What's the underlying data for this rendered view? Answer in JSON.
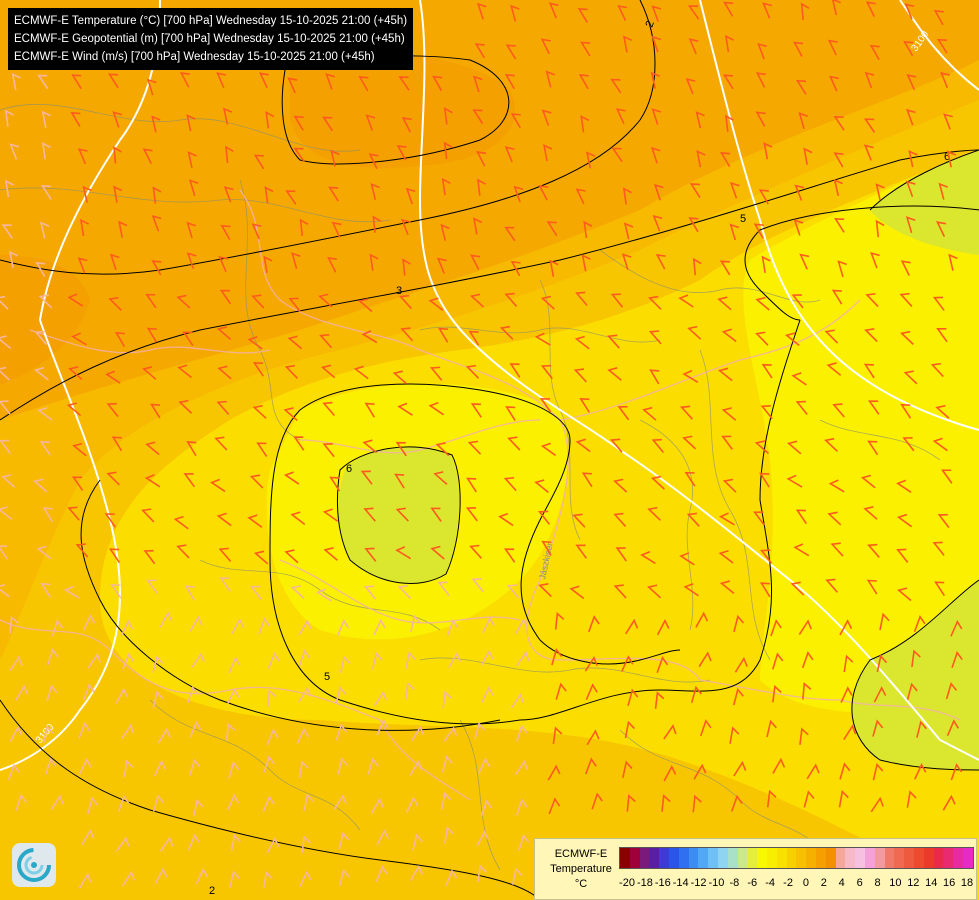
{
  "titles": [
    "ECMWF-E Temperature (°C) [700 hPa] Wednesday 15-10-2025 21:00 (+45h)",
    "ECMWF-E Geopotential (m) [700 hPa] Wednesday 15-10-2025 21:00 (+45h)",
    "ECMWF-E Wind (m/s) [700 hPa] Wednesday 15-10-2025 21:00 (+45h)"
  ],
  "map_labels": {
    "isotherm_2_top": "2",
    "isotherm_3_left": "3",
    "isotherm_5_center": "5",
    "isotherm_5_right": "5",
    "isotherm_6_center": "6",
    "isotherm_6_right": "6",
    "isotherm_2_bottom": "2",
    "geopotential_3100_bl": "3100",
    "geopotential_3100_tr": "3100",
    "river": "Jászkisér"
  },
  "legend": {
    "title_line1": "ECMWF-E",
    "title_line2": "Temperature",
    "unit": "°C",
    "ticks": [
      "-20",
      "-18",
      "-16",
      "-14",
      "-12",
      "-10",
      "-8",
      "-6",
      "-4",
      "-2",
      "0",
      "2",
      "4",
      "6",
      "8",
      "10",
      "12",
      "14",
      "16",
      "18"
    ],
    "colors": [
      "#8b0000",
      "#a0003a",
      "#7a1a7a",
      "#5a1fa0",
      "#3b3bd6",
      "#2a55e8",
      "#2f6ff0",
      "#3d8cf2",
      "#52a8f5",
      "#6fc0f5",
      "#8fd4f0",
      "#a9e0c8",
      "#cde88a",
      "#e6ee3c",
      "#f8f800",
      "#f8ee00",
      "#f8e000",
      "#f7d000",
      "#f7c000",
      "#f6b000",
      "#f5a000",
      "#f39000",
      "#f5a89a",
      "#f7b8c8",
      "#f6c0e0",
      "#f5a0d8",
      "#f29aa0",
      "#f07a6a",
      "#ef6a50",
      "#ee5a40",
      "#ee4a30",
      "#ec3a2a",
      "#ea2a4a",
      "#ea2a70",
      "#e82aa0",
      "#e62ac8"
    ]
  },
  "colors": {
    "orange_dark": "#f5a300",
    "orange": "#f8b400",
    "yellow_orange": "#f9c800",
    "yellow": "#fbe400",
    "bright_yellow": "#fdf600",
    "green_yellow": "#dbe82e",
    "wind_barb": "#ff5a1e",
    "wind_barb_light": "#f6b6a0",
    "contour": "#000000",
    "geopotential": "#ffffff"
  }
}
